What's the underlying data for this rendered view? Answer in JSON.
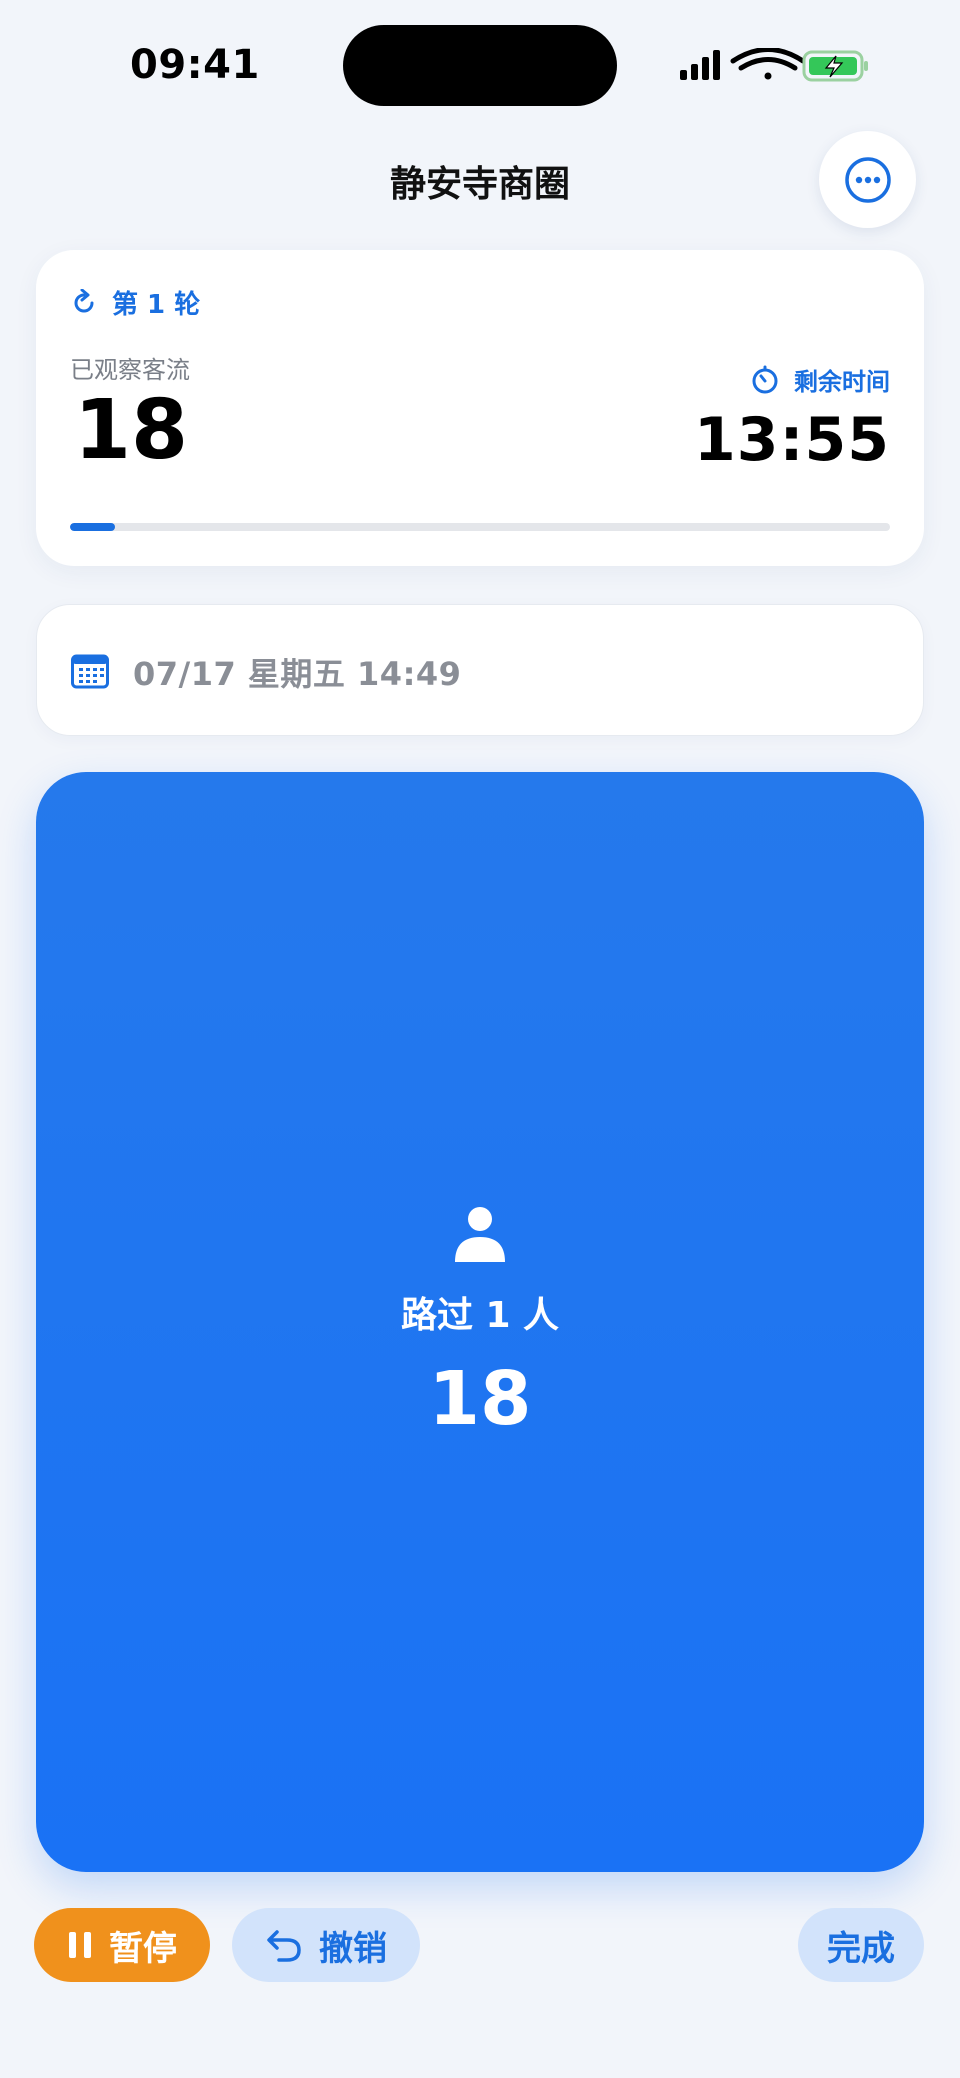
{
  "status_bar": {
    "time": "09:41",
    "signal_icon": "cellular-signal-icon",
    "wifi_icon": "wifi-icon",
    "battery_icon": "battery-charging-icon"
  },
  "header": {
    "title": "静安寺商圈",
    "more_icon": "more-options-icon"
  },
  "stats": {
    "round_label": "第 1 轮",
    "round_icon": "refresh-icon",
    "observed_label": "已观察客流",
    "observed_value": "18",
    "remaining_label": "剩余时间",
    "remaining_icon": "timer-icon",
    "remaining_value": "13:55",
    "progress_fraction": 0.055
  },
  "date_card": {
    "icon": "calendar-icon",
    "text": "07/17 星期五 14:49"
  },
  "tap_area": {
    "icon": "person-icon",
    "label": "路过 1 人",
    "count": "18"
  },
  "actions": {
    "pause_label": "暂停",
    "pause_icon": "pause-icon",
    "undo_label": "撤销",
    "undo_icon": "undo-icon",
    "done_label": "完成"
  },
  "colors": {
    "accent": "#1a6fe0",
    "tap_area": "#1a72f5",
    "pause": "#f0911c",
    "secondary_button": "#d2e3fb",
    "background": "#f2f5fa"
  }
}
